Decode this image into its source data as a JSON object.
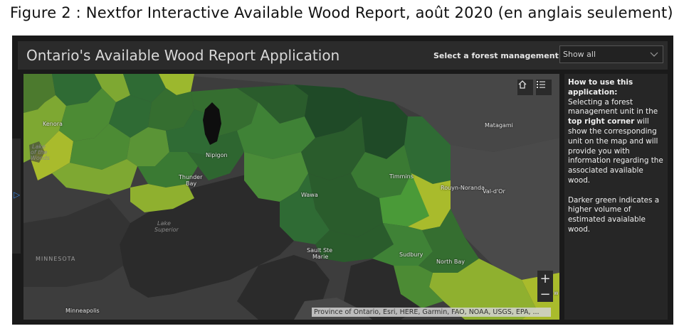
{
  "caption": "Figure 2 : Nextfor Interactive Available Wood Report, août 2020 (en anglais seulement)",
  "app": {
    "title": "Ontario's Available Wood Report Application",
    "fmu_label": "Select a forest management unit:",
    "fmu_selected": "Show all"
  },
  "side_panel": {
    "heading": "How to use this application:",
    "p1_a": "Selecting a forest management unit in the ",
    "p1_bold": "top right corner",
    "p1_b": " will show the corresponding unit on the map and will provide you with information regarding the associated available wood.",
    "p2": "Darker green indicates a higher volume of estimated avaialable wood."
  },
  "map": {
    "places": {
      "kenora": "Kenora",
      "lake_of_the_woods_1": "Lake",
      "lake_of_the_woods_2": "of the",
      "lake_of_the_woods_3": "Woods",
      "nipigon": "Nipigon",
      "thunder_bay_1": "Thunder",
      "thunder_bay_2": "Bay",
      "matagami": "Matagami",
      "timmins": "Timmins",
      "rouyn": "Rouyn-Noranda",
      "valdor": "Val-d'Or",
      "wawa": "Wawa",
      "lake_superior_1": "Lake",
      "lake_superior_2": "Superior",
      "sault_1": "Sault Ste",
      "sault_2": "Marie",
      "sudbury": "Sudbury",
      "north_bay": "North Bay",
      "minnesota": "MINNESOTA",
      "minneapolis": "Minneapolis",
      "edge_w": "w"
    },
    "zoom_in": "+",
    "zoom_out": "−",
    "attribution": "Province of Ontario, Esri, HERE, Garmin, FAO, NOAA, USGS, EPA, ..."
  },
  "icons": [
    "home-icon",
    "legend-list-icon",
    "chevron-down-icon",
    "expand-panel-icon"
  ],
  "colors": {
    "darkest_green": "#1f4a27",
    "dark_green": "#2f6b34",
    "mid_green": "#4c8b34",
    "light_green": "#7ea832",
    "yellow_green": "#a9bb2c"
  }
}
